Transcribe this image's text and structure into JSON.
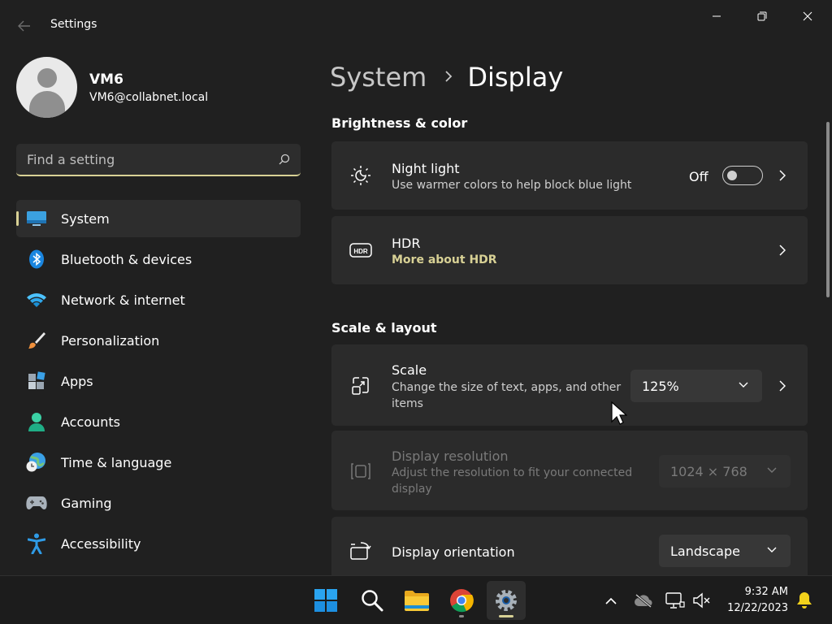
{
  "window": {
    "title": "Settings",
    "controls": {
      "minimize": "minimize",
      "maximize": "maximize",
      "close": "close"
    }
  },
  "profile": {
    "name": "VM6",
    "email": "VM6@collabnet.local"
  },
  "search": {
    "placeholder": "Find a setting"
  },
  "sidebar": {
    "items": [
      {
        "label": "System",
        "icon": "system-icon",
        "active": true
      },
      {
        "label": "Bluetooth & devices",
        "icon": "bluetooth-icon"
      },
      {
        "label": "Network & internet",
        "icon": "wifi-icon"
      },
      {
        "label": "Personalization",
        "icon": "brush-icon"
      },
      {
        "label": "Apps",
        "icon": "apps-icon"
      },
      {
        "label": "Accounts",
        "icon": "accounts-icon"
      },
      {
        "label": "Time & language",
        "icon": "globe-clock-icon"
      },
      {
        "label": "Gaming",
        "icon": "gamepad-icon"
      },
      {
        "label": "Accessibility",
        "icon": "accessibility-icon"
      }
    ]
  },
  "breadcrumb": {
    "parent": "System",
    "current": "Display"
  },
  "sections": {
    "brightness": "Brightness & color",
    "scale_layout": "Scale & layout"
  },
  "night_light": {
    "title": "Night light",
    "subtitle": "Use warmer colors to help block blue light",
    "toggle_state": "Off"
  },
  "hdr": {
    "title": "HDR",
    "link": "More about HDR"
  },
  "scale": {
    "title": "Scale",
    "subtitle": "Change the size of text, apps, and other items",
    "value": "125%"
  },
  "resolution": {
    "title": "Display resolution",
    "subtitle": "Adjust the resolution to fit your connected display",
    "value": "1024 × 768"
  },
  "orientation": {
    "title": "Display orientation",
    "value": "Landscape"
  },
  "taskbar": {
    "clock_time": "9:32 AM",
    "clock_date": "12/22/2023"
  },
  "colors": {
    "accent": "#d8d195",
    "background": "#202020",
    "card": "#2b2b2b"
  }
}
